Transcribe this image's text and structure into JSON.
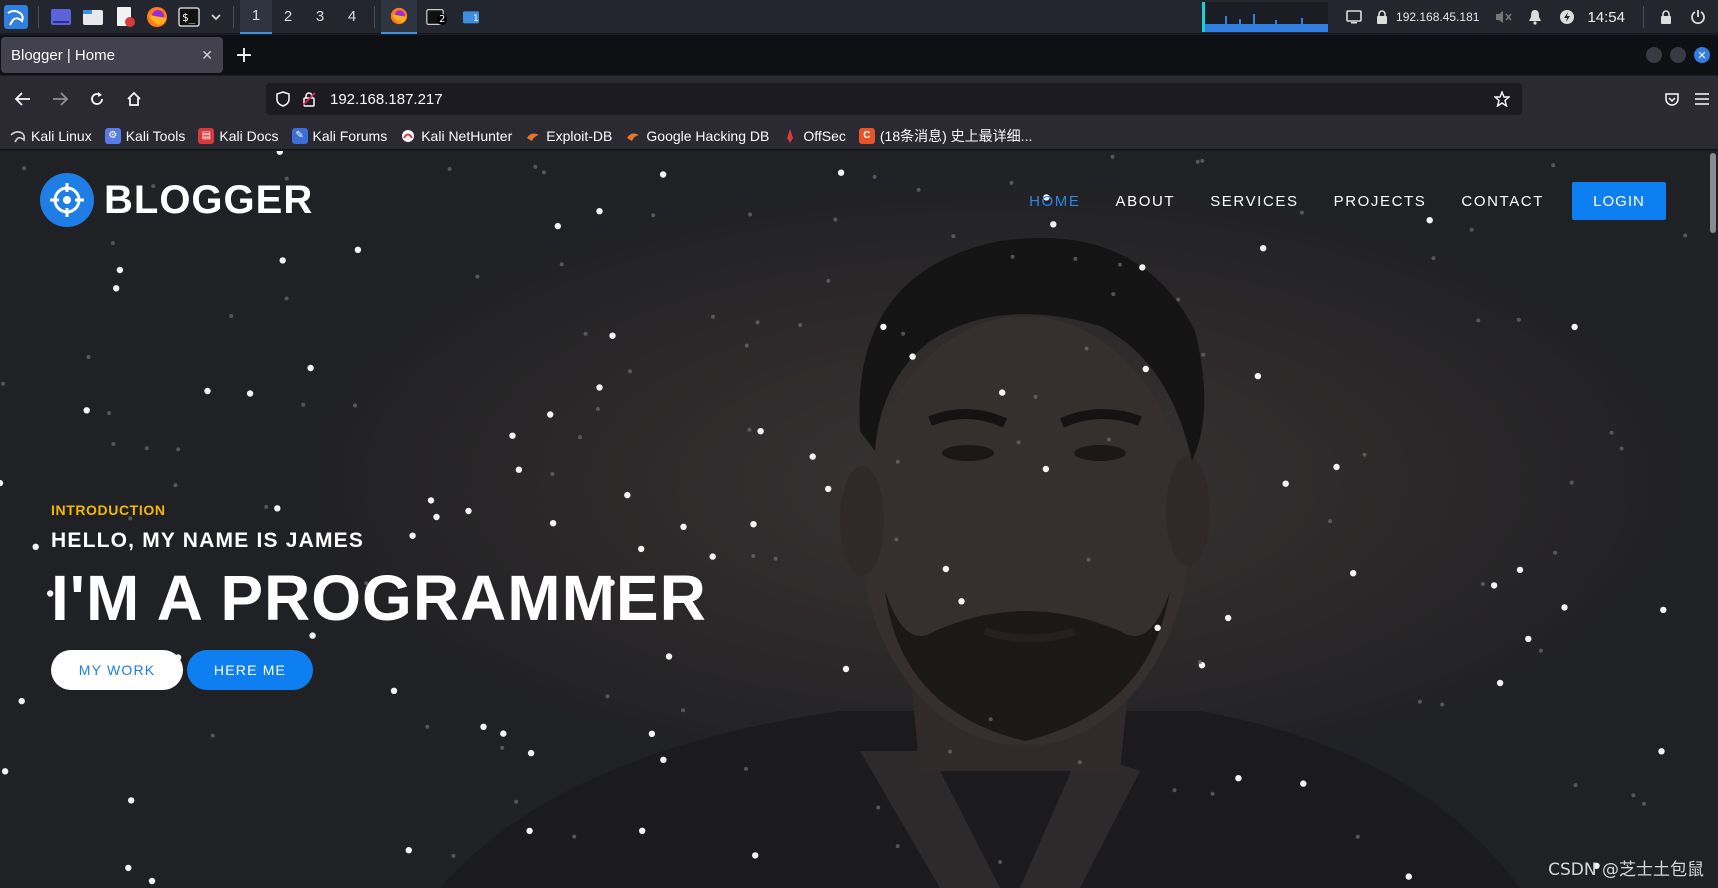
{
  "panel": {
    "workspaces": [
      "1",
      "2",
      "3",
      "4"
    ],
    "active_workspace": "1",
    "ip_address": "192.168.45.181",
    "clock": "14:54",
    "terminal_badge": "2",
    "files_badge": "1"
  },
  "browser": {
    "tab_title": "Blogger | Home",
    "tab_close": "✕",
    "new_tab": "+",
    "url": "192.168.187.217",
    "bookmarks": [
      {
        "label": "Kali Linux",
        "icon": "kali-dragon-icon",
        "color": "#cfd2d6"
      },
      {
        "label": "Kali Tools",
        "icon": "kali-tools-icon",
        "color": "#5a7ce8"
      },
      {
        "label": "Kali Docs",
        "icon": "kali-docs-icon",
        "color": "#d83a3a"
      },
      {
        "label": "Kali Forums",
        "icon": "kali-forums-icon",
        "color": "#3b6fd6"
      },
      {
        "label": "Kali NetHunter",
        "icon": "nethunter-icon",
        "color": "#d83a3a"
      },
      {
        "label": "Exploit-DB",
        "icon": "exploit-db-icon",
        "color": "#e8752a"
      },
      {
        "label": "Google Hacking DB",
        "icon": "ghdb-icon",
        "color": "#e8752a"
      },
      {
        "label": "OffSec",
        "icon": "offsec-icon",
        "color": "#d83a3a"
      },
      {
        "label": "(18条消息) 史上最详细...",
        "icon": "csdn-icon",
        "color": "#e8542a"
      }
    ]
  },
  "site": {
    "logo_text": "BLOGGER",
    "nav": [
      {
        "label": "HOME",
        "current": true
      },
      {
        "label": "ABOUT",
        "current": false
      },
      {
        "label": "SERVICES",
        "current": false
      },
      {
        "label": "PROJECTS",
        "current": false
      },
      {
        "label": "CONTACT",
        "current": false
      }
    ],
    "login_label": "LOGIN",
    "kicker": "INTRODUCTION",
    "hello": "HELLO, MY NAME IS JAMES",
    "title": "I'M A PROGRAMMER",
    "btn_work": "MY WORK",
    "btn_here": "HERE ME",
    "accent": "#0d7ff0",
    "kicker_color": "#f5b800"
  },
  "watermark": "CSDN @芝士土包鼠"
}
